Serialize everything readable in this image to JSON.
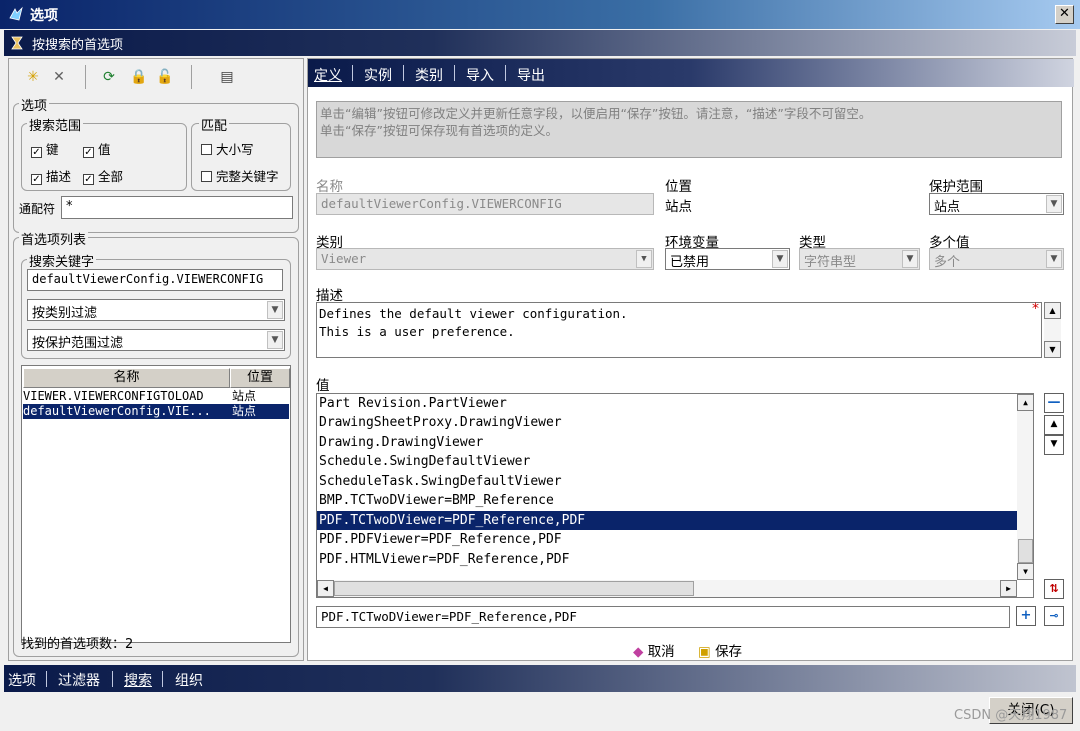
{
  "window": {
    "title": "选项",
    "close_glyph": "✕",
    "icon": "app-icon"
  },
  "subheader": {
    "title": "按搜索的首选项",
    "icon": "search-prefs-icon"
  },
  "toolbar": {
    "icons": [
      "new-icon",
      "delete-icon",
      "refresh-icon",
      "lock-icon",
      "unlock-icon",
      "export-icon"
    ]
  },
  "options": {
    "legend": "选项",
    "search_scope": {
      "legend": "搜索范围",
      "key": {
        "label": "键",
        "checked": true
      },
      "value": {
        "label": "值",
        "checked": true
      },
      "description": {
        "label": "描述",
        "checked": true
      },
      "all": {
        "label": "全部",
        "checked": true
      }
    },
    "match": {
      "legend": "匹配",
      "case": {
        "label": "大小写",
        "checked": false
      },
      "whole_word": {
        "label": "完整关键字",
        "checked": false
      }
    },
    "wildcard_label": "通配符",
    "wildcard_value": "*"
  },
  "pref_list": {
    "legend": "首选项列表",
    "search_keyword_legend": "搜索关键字",
    "search_keyword_value": "defaultViewerConfig.VIEWERCONFIG",
    "filter_category": "按类别过滤",
    "filter_scope": "按保护范围过滤",
    "columns": [
      "名称",
      "位置"
    ],
    "rows": [
      {
        "name": "VIEWER.VIEWERCONFIGTOLOAD",
        "location": "站点",
        "selected": false
      },
      {
        "name": "defaultViewerConfig.VIE...",
        "location": "站点",
        "selected": true
      }
    ],
    "found_count": "找到的首选项数：2"
  },
  "tabs": [
    "定义",
    "实例",
    "类别",
    "导入",
    "导出"
  ],
  "definition": {
    "info_text_1": "单击“编辑”按钮可修改定义并更新任意字段，以便启用“保存”按钮。请注意，“描述”字段不可留空。",
    "info_text_2": "单击“保存”按钮可保存现有首选项的定义。",
    "name_label": "名称",
    "name_value": "defaultViewerConfig.VIEWERCONFIG",
    "location_label": "位置",
    "location_value": "站点",
    "scope_label": "保护范围",
    "scope_value": "站点",
    "category_label": "类别",
    "category_value": "Viewer",
    "env_label": "环境变量",
    "env_value": "已禁用",
    "type_label": "类型",
    "type_value": "字符串型",
    "multi_label": "多个值",
    "multi_value": "多个",
    "desc_label": "描述",
    "desc_line1": "Defines the default viewer configuration.",
    "desc_line2": "This is a user preference.",
    "required_mark": "*",
    "values_label": "值",
    "values": [
      "Part Revision.PartViewer",
      "DrawingSheetProxy.DrawingViewer",
      "Drawing.DrawingViewer",
      "Schedule.SwingDefaultViewer",
      "ScheduleTask.SwingDefaultViewer",
      "BMP.TCTwoDViewer=BMP_Reference",
      "PDF.TCTwoDViewer=PDF_Reference,PDF",
      "PDF.PDFViewer=PDF_Reference,PDF",
      "PDF.HTMLViewer=PDF_Reference,PDF"
    ],
    "selected_value_index": 6,
    "edit_value": "PDF.TCTwoDViewer=PDF_Reference,PDF",
    "cancel_label": "取消",
    "save_label": "保存"
  },
  "bottom_tabs": [
    "选项",
    "过滤器",
    "搜索",
    "组织"
  ],
  "close_button": "关闭(C)",
  "watermark": "CSDN @天翔1987"
}
